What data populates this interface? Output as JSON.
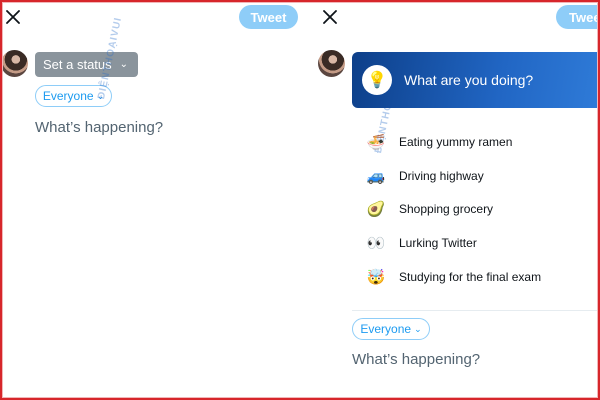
{
  "left_panel": {
    "tweet_label": "Tweet",
    "status_button_label": "Set a status",
    "audience_label": "Everyone",
    "compose_placeholder": "What’s happening?",
    "watermark": "ĐIỆNTHOẠIVUI"
  },
  "right_panel": {
    "tweet_label": "Twee",
    "status_prompt": "What are you doing?",
    "status_options": [
      {
        "label": "Eating yummy ramen",
        "icon": "ramen-icon",
        "glyph": "🍜"
      },
      {
        "label": "Driving highway",
        "icon": "car-icon",
        "glyph": "🚙"
      },
      {
        "label": "Shopping grocery",
        "icon": "avocado-icon",
        "glyph": "🥑"
      },
      {
        "label": "Lurking Twitter",
        "icon": "peeking-eyes-icon",
        "glyph": "👀"
      },
      {
        "label": "Studying for the final exam",
        "icon": "exploding-head-icon",
        "glyph": "🤯"
      }
    ],
    "audience_label": "Everyone",
    "compose_placeholder": "What’s happening?",
    "watermark": "ĐIỆNTHOẠIVUI"
  },
  "colors": {
    "accent": "#1d9bf0",
    "tweet_button": "#8ecdf8",
    "status_header_start": "#0d3f89",
    "status_header_end": "#2f7bd8",
    "frame_border": "#d7262b"
  }
}
